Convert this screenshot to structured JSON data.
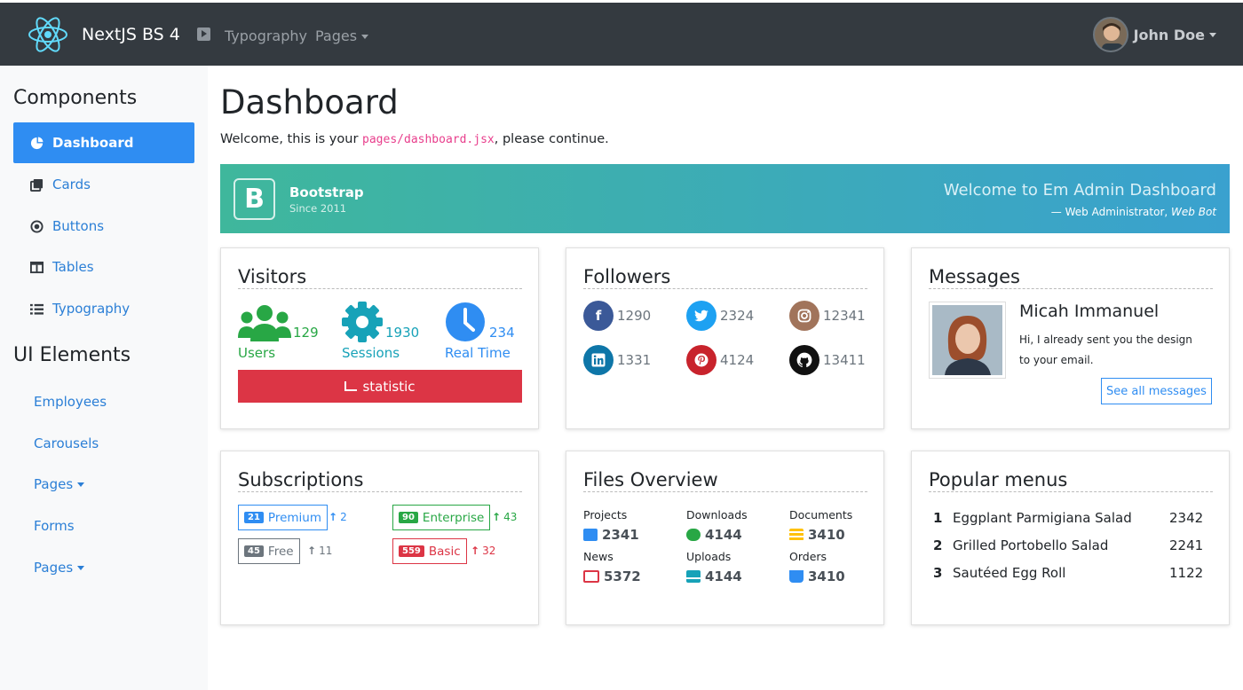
{
  "navbar": {
    "brand": "NextJS BS 4",
    "links": [
      "Typography",
      "Pages"
    ],
    "user_name": "John Doe"
  },
  "sidebar": {
    "components_heading": "Components",
    "components": [
      {
        "label": "Dashboard",
        "icon": "pie-chart-icon",
        "active": true
      },
      {
        "label": "Cards",
        "icon": "clone-icon"
      },
      {
        "label": "Buttons",
        "icon": "dot-circle-icon"
      },
      {
        "label": "Tables",
        "icon": "table-icon"
      },
      {
        "label": "Typography",
        "icon": "list-icon"
      }
    ],
    "ui_heading": "UI Elements",
    "ui": [
      "Employees",
      "Carousels",
      "Pages",
      "Forms",
      "Pages"
    ]
  },
  "page": {
    "title": "Dashboard",
    "welcome_pre": "Welcome, this is your ",
    "welcome_code": "pages/dashboard.jsx",
    "welcome_post": ", please continue."
  },
  "banner": {
    "logo_letter": "B",
    "name": "Bootstrap",
    "since": "Since 2011",
    "headline": "Welcome to Em Admin Dashboard",
    "attribution": "— Web Administrator, ",
    "attribution_italic": "Web Bot"
  },
  "visitors": {
    "title": "Visitors",
    "stats": [
      {
        "label": "Users",
        "value": "129",
        "icon": "users-icon",
        "color": "#28a745"
      },
      {
        "label": "Sessions",
        "value": "1930",
        "icon": "cog-icon",
        "color": "#17a2b8"
      },
      {
        "label": "Real Time",
        "value": "234",
        "icon": "clock-icon",
        "color": "#2f8df2"
      }
    ],
    "button": "statistic"
  },
  "followers": {
    "title": "Followers",
    "items": [
      {
        "network": "facebook-icon",
        "value": "1290",
        "color": "#3b5998"
      },
      {
        "network": "twitter-icon",
        "value": "2324",
        "color": "#1da1f2"
      },
      {
        "network": "instagram-icon",
        "value": "12341",
        "color": "#a1745b"
      },
      {
        "network": "linkedin-icon",
        "value": "1331",
        "color": "#0e76a8"
      },
      {
        "network": "pinterest-icon",
        "value": "4124",
        "color": "#c8232c"
      },
      {
        "network": "github-icon",
        "value": "13411",
        "color": "#111111"
      }
    ]
  },
  "messages": {
    "title": "Messages",
    "name": "Micah Immanuel",
    "text": "Hi, I already sent you the design to your email.",
    "button": "See all messages"
  },
  "subscriptions": {
    "title": "Subscriptions",
    "items": [
      {
        "badge": "21",
        "label": "Premium",
        "up": "2",
        "color": "#2f8df2"
      },
      {
        "badge": "90",
        "label": "Enterprise",
        "up": "43",
        "color": "#28a745"
      },
      {
        "badge": "45",
        "label": "Free",
        "up": "11",
        "color": "#6c757d"
      },
      {
        "badge": "559",
        "label": "Basic",
        "up": "32",
        "color": "#dc3545"
      }
    ]
  },
  "files": {
    "title": "Files Overview",
    "items": [
      {
        "label": "Projects",
        "value": "2341",
        "color": "#2f8df2",
        "icon": "briefcase-icon"
      },
      {
        "label": "Downloads",
        "value": "4144",
        "color": "#28a745",
        "icon": "cloud-download-icon"
      },
      {
        "label": "Documents",
        "value": "3410",
        "color": "#ffc107",
        "icon": "list-icon"
      },
      {
        "label": "News",
        "value": "5372",
        "color": "#dc3545",
        "icon": "newspaper-icon"
      },
      {
        "label": "Uploads",
        "value": "4144",
        "color": "#17a2b8",
        "icon": "upload-icon"
      },
      {
        "label": "Orders",
        "value": "3410",
        "color": "#2f8df2",
        "icon": "cart-icon"
      }
    ]
  },
  "popular": {
    "title": "Popular menus",
    "items": [
      {
        "idx": "1",
        "name": "Eggplant Parmigiana Salad",
        "count": "2342"
      },
      {
        "idx": "2",
        "name": "Grilled Portobello Salad",
        "count": "2241"
      },
      {
        "idx": "3",
        "name": "Sautéed Egg Roll",
        "count": "1122"
      }
    ]
  }
}
